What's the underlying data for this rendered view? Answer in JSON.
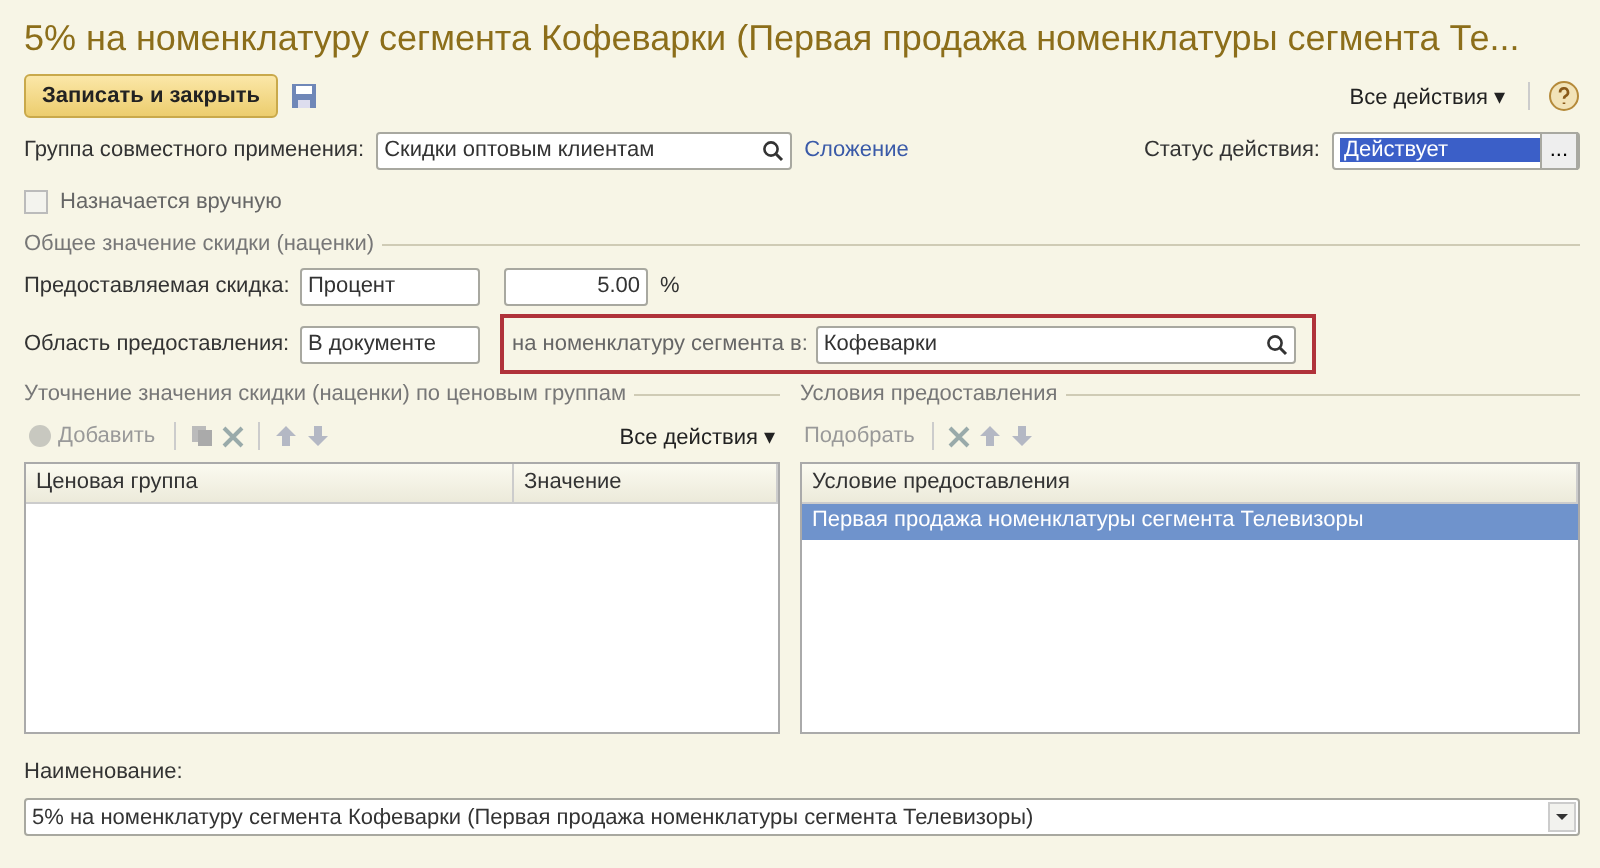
{
  "window": {
    "title": "5% на номенклатуру сегмента Кофеварки (Первая продажа номенклатуры сегмента Те..."
  },
  "toolbar": {
    "save_close": "Записать и закрыть",
    "all_actions": "Все действия",
    "all_actions_caret": "▾"
  },
  "joint_group": {
    "label": "Группа совместного применения:",
    "value": "Скидки оптовым клиентам",
    "link": "Сложение"
  },
  "status": {
    "label": "Статус действия:",
    "value": "Действует",
    "selected": true,
    "button": "..."
  },
  "manual": {
    "label": "Назначается вручную",
    "checked": false
  },
  "general_group": {
    "title": "Общее значение скидки (наценки)",
    "discount": {
      "label": "Предоставляемая скидка:",
      "type": "Процент",
      "value": "5.00",
      "unit": "%"
    },
    "scope": {
      "label": "Область предоставления:",
      "value": "В документе",
      "segment_label": "на номенклатуру сегмента в:",
      "segment_value": "Кофеварки"
    }
  },
  "price_groups": {
    "title": "Уточнение значения скидки (наценки) по ценовым группам",
    "add": "Добавить",
    "all_actions": "Все действия",
    "all_actions_caret": "▾",
    "columns": [
      "Ценовая группа",
      "Значение"
    ]
  },
  "conditions": {
    "title": "Условия предоставления",
    "pick": "Подобрать",
    "columns": [
      "Условие предоставления"
    ],
    "rows": [
      {
        "text": "Первая продажа номенклатуры сегмента Телевизоры",
        "selected": true
      }
    ]
  },
  "name": {
    "label": "Наименование:",
    "value": "5% на номенклатуру сегмента Кофеварки (Первая продажа номенклатуры сегмента Телевизоры)"
  }
}
